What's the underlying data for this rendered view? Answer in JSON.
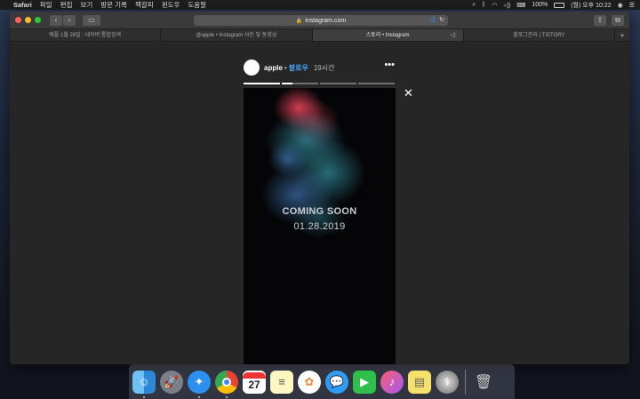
{
  "menubar": {
    "app_name": "Safari",
    "items": [
      "파일",
      "편집",
      "보기",
      "방문 기록",
      "책갈피",
      "윈도우",
      "도움말"
    ],
    "battery": "100%",
    "datetime": "(월) 오후 10:22"
  },
  "browser": {
    "url": "instagram.com",
    "tabs": [
      {
        "label": "애플 1월 28일 : 네이버 통합검색",
        "active": false
      },
      {
        "label": "@apple • Instagram 사진 및 동영상",
        "active": false
      },
      {
        "label": "스토리 • Instagram",
        "active": true
      },
      {
        "label": "블로그관리 | TISTORY",
        "active": false
      }
    ]
  },
  "story": {
    "username": "apple",
    "separator": "•",
    "follow_label": "팔로우",
    "time": "19시간",
    "headline": "COMING SOON",
    "date_line": "01.28.2019",
    "segments": [
      1.0,
      0.3,
      0,
      0
    ],
    "colors": {
      "follow": "#4aa3ff"
    }
  },
  "dock": {
    "icons": [
      "finder-icon",
      "launchpad-icon",
      "safari-icon",
      "chrome-icon",
      "calendar-icon",
      "notes-icon",
      "photos-icon",
      "messages-icon",
      "facetime-icon",
      "itunes-icon",
      "stickies-icon",
      "disk-utility-icon",
      "trash-icon"
    ],
    "calendar_day": "27"
  }
}
